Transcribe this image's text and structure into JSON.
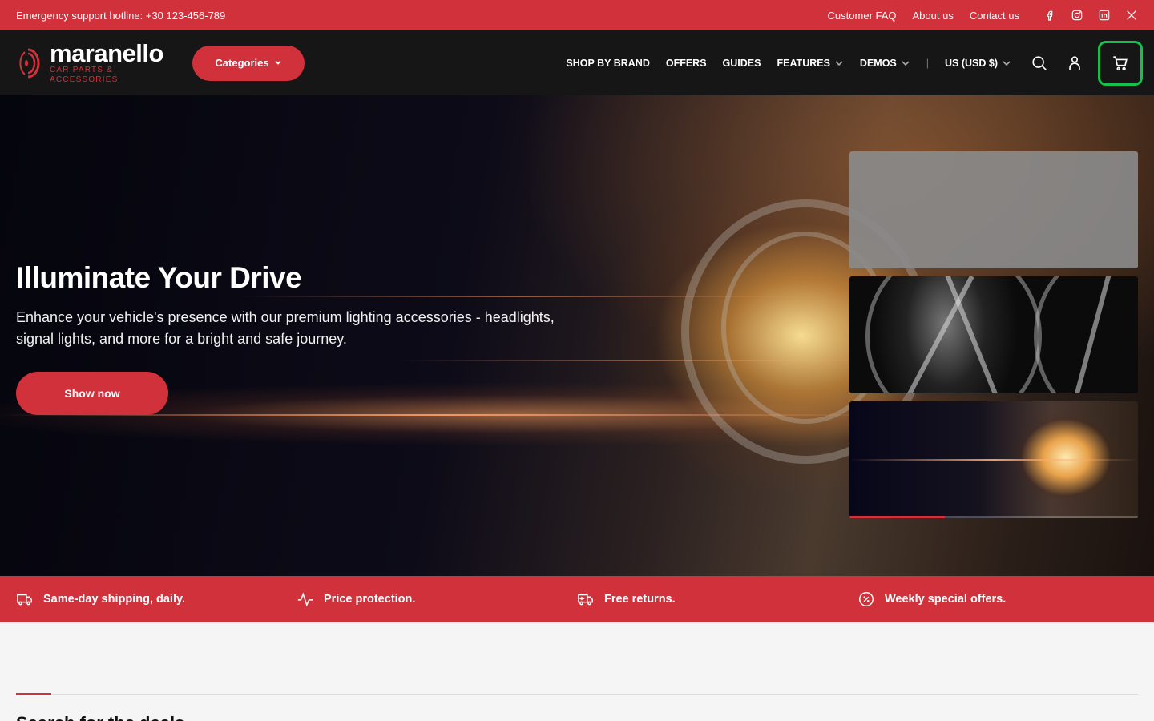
{
  "topbar": {
    "hotline": "Emergency support hotline: +30 123-456-789",
    "links": [
      "Customer FAQ",
      "About us",
      "Contact us"
    ],
    "social_icons": [
      "facebook-icon",
      "instagram-icon",
      "linkedin-icon",
      "x-icon"
    ]
  },
  "header": {
    "logo_name": "maranello",
    "logo_tagline": "CAR PARTS & ACCESSORIES",
    "categories_label": "Categories",
    "nav": {
      "shop_by_brand": "SHOP BY BRAND",
      "offers": "OFFERS",
      "guides": "GUIDES",
      "features": "FEATURES",
      "demos": "DEMOS",
      "separator": "|",
      "currency": "US (USD $)"
    },
    "icons": [
      "search-icon",
      "user-icon",
      "cart-icon"
    ]
  },
  "hero": {
    "title": "Illuminate Your Drive",
    "description": "Enhance your vehicle's presence with our premium lighting accessories - headlights, signal lights, and more for a bright and safe journey.",
    "cta_label": "Show now",
    "slide_progress": 0.33
  },
  "features": [
    {
      "icon": "truck-icon",
      "label": "Same-day shipping, daily."
    },
    {
      "icon": "pulse-icon",
      "label": "Price protection."
    },
    {
      "icon": "return-truck-icon",
      "label": "Free returns."
    },
    {
      "icon": "discount-badge-icon",
      "label": "Weekly special offers."
    }
  ],
  "section": {
    "title": "Search for the deals"
  },
  "colors": {
    "brand_red": "#d1313b",
    "header_bg": "#161616",
    "focus_green": "#12c24a"
  }
}
